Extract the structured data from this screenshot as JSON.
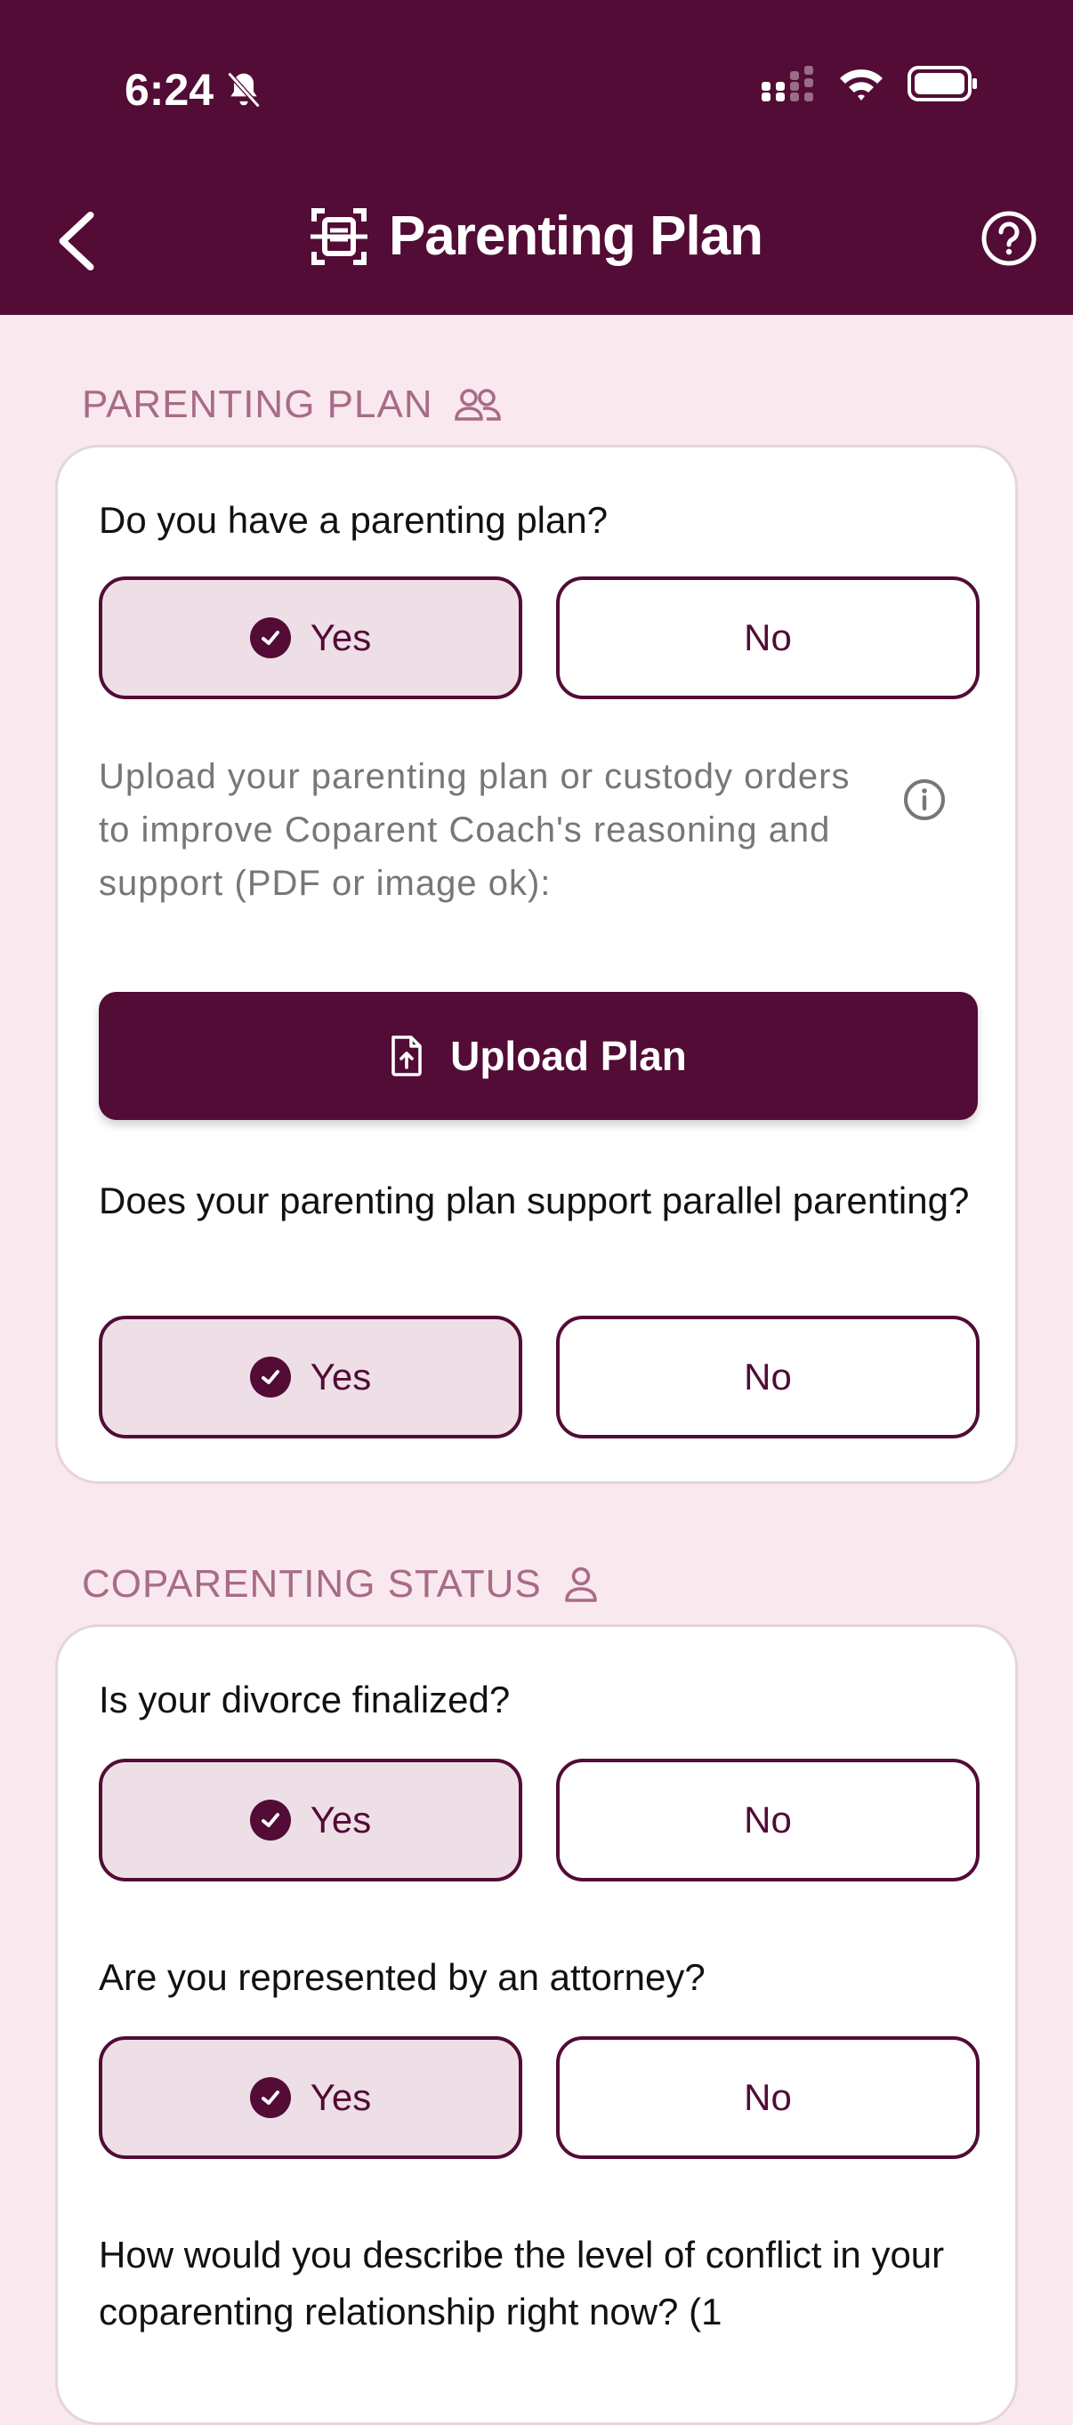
{
  "status_bar": {
    "time": "6:24"
  },
  "nav": {
    "title": "Parenting Plan"
  },
  "sections": [
    {
      "header": "PARENTING PLAN",
      "questions": [
        {
          "text": "Do you have a parenting plan?",
          "yes": "Yes",
          "no": "No",
          "selected": "Yes"
        },
        {
          "text": "Does your parenting plan support parallel parenting?",
          "yes": "Yes",
          "no": "No",
          "selected": "Yes"
        }
      ],
      "helper_text": "Upload your parenting plan or custody orders to improve Coparent Coach's reasoning and support (PDF or image ok):",
      "upload_label": "Upload Plan"
    },
    {
      "header": "COPARENTING STATUS",
      "questions": [
        {
          "text": "Is your divorce finalized?",
          "yes": "Yes",
          "no": "No",
          "selected": "Yes"
        },
        {
          "text": "Are you represented by an attorney?",
          "yes": "Yes",
          "no": "No",
          "selected": "Yes"
        },
        {
          "text": "How would you describe the level of conflict in your coparenting relationship right now? (1"
        }
      ]
    }
  ],
  "colors": {
    "brand": "#520C36",
    "background": "#F9E9EF",
    "selected_fill": "#EEDFE7",
    "section_label": "#A86B88"
  },
  "icons": [
    "back-chevron-icon",
    "document-scan-icon",
    "help-icon",
    "people-icon",
    "person-icon",
    "info-icon",
    "file-upload-icon",
    "check-circle-icon",
    "bell-off-icon",
    "signal-icon",
    "wifi-icon",
    "battery-icon"
  ]
}
